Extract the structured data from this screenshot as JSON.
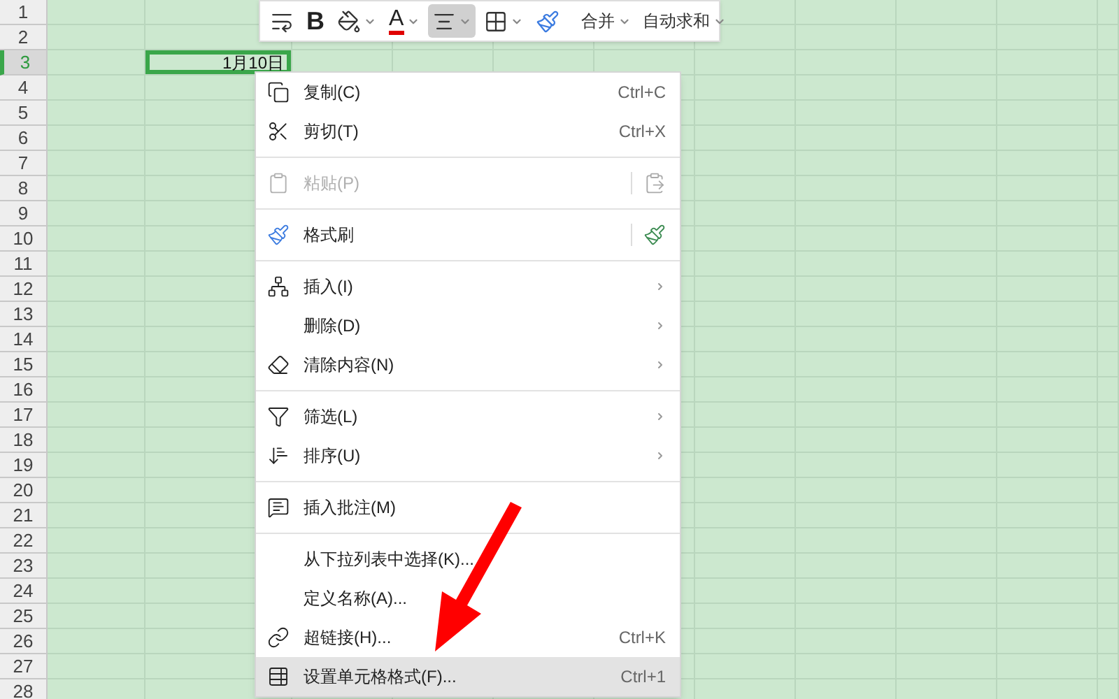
{
  "toolbar": {
    "items": [
      {
        "kind": "icon",
        "dropdown": false,
        "selected": false
      },
      {
        "kind": "letter",
        "label": "B",
        "dropdown": false,
        "selected": false
      },
      {
        "kind": "icon",
        "dropdown": true,
        "selected": false
      },
      {
        "kind": "letter",
        "label": "A",
        "dropdown": true,
        "selected": false
      },
      {
        "kind": "icon",
        "dropdown": true,
        "selected": true
      },
      {
        "kind": "icon",
        "dropdown": true,
        "selected": false
      },
      {
        "kind": "icon",
        "dropdown": false,
        "selected": false
      },
      {
        "kind": "text",
        "label": "合并",
        "dropdown": true,
        "selected": false
      },
      {
        "kind": "text",
        "label": "自动求和",
        "dropdown": true,
        "selected": false
      }
    ]
  },
  "sheet": {
    "rows": [
      {
        "label": "1",
        "selected": false
      },
      {
        "label": "2",
        "selected": false
      },
      {
        "label": "3",
        "selected": true
      },
      {
        "label": "4",
        "selected": false
      },
      {
        "label": "5",
        "selected": false
      },
      {
        "label": "6",
        "selected": false
      },
      {
        "label": "7",
        "selected": false
      },
      {
        "label": "8",
        "selected": false
      },
      {
        "label": "9",
        "selected": false
      },
      {
        "label": "10",
        "selected": false
      },
      {
        "label": "11",
        "selected": false
      },
      {
        "label": "12",
        "selected": false
      },
      {
        "label": "13",
        "selected": false
      },
      {
        "label": "14",
        "selected": false
      },
      {
        "label": "15",
        "selected": false
      },
      {
        "label": "16",
        "selected": false
      },
      {
        "label": "17",
        "selected": false
      },
      {
        "label": "18",
        "selected": false
      },
      {
        "label": "19",
        "selected": false
      },
      {
        "label": "20",
        "selected": false
      },
      {
        "label": "21",
        "selected": false
      },
      {
        "label": "22",
        "selected": false
      },
      {
        "label": "23",
        "selected": false
      },
      {
        "label": "24",
        "selected": false
      },
      {
        "label": "25",
        "selected": false
      },
      {
        "label": "26",
        "selected": false
      },
      {
        "label": "27",
        "selected": false
      },
      {
        "label": "28",
        "selected": false
      }
    ],
    "active_cell": {
      "text": "1月10日"
    }
  },
  "context_menu": {
    "groups": [
      [
        {
          "label": "复制(C)",
          "shortcut": "Ctrl+C",
          "submenu": false,
          "side_action": false,
          "disabled": false,
          "selected": false
        },
        {
          "label": "剪切(T)",
          "shortcut": "Ctrl+X",
          "submenu": false,
          "side_action": false,
          "disabled": false,
          "selected": false
        }
      ],
      [
        {
          "label": "粘贴(P)",
          "submenu": false,
          "side_action": true,
          "disabled": true,
          "selected": false
        }
      ],
      [
        {
          "label": "格式刷",
          "submenu": false,
          "side_action": true,
          "disabled": false,
          "selected": false
        }
      ],
      [
        {
          "label": "插入(I)",
          "submenu": true,
          "side_action": false,
          "disabled": false,
          "selected": false
        },
        {
          "label": "删除(D)",
          "submenu": true,
          "side_action": false,
          "disabled": false,
          "selected": false
        },
        {
          "label": "清除内容(N)",
          "submenu": true,
          "side_action": false,
          "disabled": false,
          "selected": false
        }
      ],
      [
        {
          "label": "筛选(L)",
          "submenu": true,
          "side_action": false,
          "disabled": false,
          "selected": false
        },
        {
          "label": "排序(U)",
          "submenu": true,
          "side_action": false,
          "disabled": false,
          "selected": false
        }
      ],
      [
        {
          "label": "插入批注(M)",
          "submenu": false,
          "side_action": false,
          "disabled": false,
          "selected": false
        }
      ],
      [
        {
          "label": "从下拉列表中选择(K)...",
          "submenu": false,
          "side_action": false,
          "disabled": false,
          "selected": false
        },
        {
          "label": "定义名称(A)...",
          "submenu": false,
          "side_action": false,
          "disabled": false,
          "selected": false
        },
        {
          "label": "超链接(H)...",
          "shortcut": "Ctrl+K",
          "submenu": false,
          "side_action": false,
          "disabled": false,
          "selected": false
        },
        {
          "label": "设置单元格格式(F)...",
          "shortcut": "Ctrl+1",
          "submenu": false,
          "side_action": false,
          "disabled": false,
          "selected": true
        }
      ]
    ]
  }
}
